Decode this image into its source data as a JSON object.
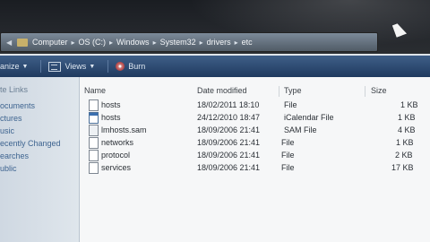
{
  "address": {
    "crumbs": [
      "Computer",
      "OS (C:)",
      "Windows",
      "System32",
      "drivers",
      "etc"
    ]
  },
  "toolbar": {
    "organize_label": "anize",
    "views_label": "Views",
    "burn_label": "Burn"
  },
  "sidebar": {
    "heading": "te Links",
    "items": [
      "ocuments",
      "ctures",
      "usic",
      "ecently Changed",
      "earches",
      "ublic"
    ]
  },
  "columns": {
    "name": "Name",
    "date": "Date modified",
    "type": "Type",
    "size": "Size"
  },
  "files": [
    {
      "name": "hosts",
      "date": "18/02/2011 18:10",
      "type": "File",
      "size": "1 KB",
      "icon": "file-icon"
    },
    {
      "name": "hosts",
      "date": "24/12/2010 18:47",
      "type": "iCalendar File",
      "size": "1 KB",
      "icon": "calendar-file-icon"
    },
    {
      "name": "lmhosts.sam",
      "date": "18/09/2006 21:41",
      "type": "SAM File",
      "size": "4 KB",
      "icon": "file-icon"
    },
    {
      "name": "networks",
      "date": "18/09/2006 21:41",
      "type": "File",
      "size": "1 KB",
      "icon": "file-icon"
    },
    {
      "name": "protocol",
      "date": "18/09/2006 21:41",
      "type": "File",
      "size": "2 KB",
      "icon": "file-icon"
    },
    {
      "name": "services",
      "date": "18/09/2006 21:41",
      "type": "File",
      "size": "17 KB",
      "icon": "file-icon"
    }
  ]
}
